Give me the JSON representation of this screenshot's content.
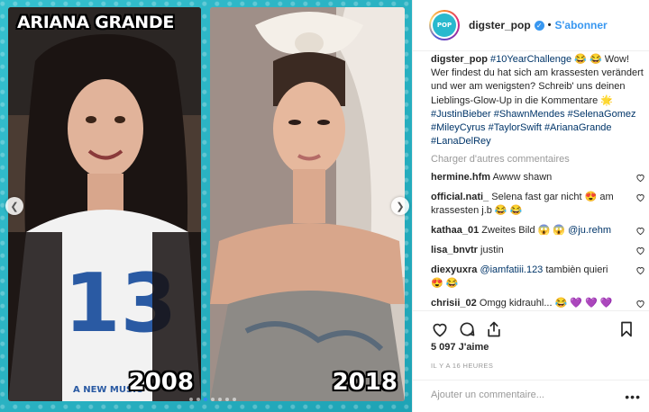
{
  "post": {
    "left_label": "ARIANA GRANDE",
    "left_year": "2008",
    "right_year": "2018",
    "shirt_text": "A NEW MUSIC"
  },
  "header": {
    "avatar_text": "POP",
    "username": "digster_pop",
    "separator": "•",
    "follow_label": "S'abonner"
  },
  "caption": {
    "username": "digster_pop",
    "hashtag": "#10YearChallenge",
    "emojis": "😂 😂",
    "text": " Wow! Wer findest du hat sich am krassesten verändert und wer am wenigsten? Schreib' uns deinen Lieblings-Glow-Up in die Kommentare 🌟 ",
    "tags": [
      "#JustinBieber",
      "#ShawnMendes",
      "#SelenaGomez",
      "#MileyCyrus",
      "#TaylorSwift",
      "#ArianaGrande",
      "#LanaDelRey"
    ]
  },
  "load_more": "Charger d'autres commentaires",
  "comments": [
    {
      "user": "hermine.hfm",
      "text": " Awww shawn"
    },
    {
      "user": "official.nati_",
      "text": " Selena fast gar nicht 😍 am krassesten j.b 😂 😂"
    },
    {
      "user": "kathaa_01",
      "text": " Zweites Bild 😱 😱 ",
      "mention": "@ju.rehm"
    },
    {
      "user": "lisa_bnvtr",
      "text": " justin"
    },
    {
      "user": "diexyuxra",
      "text": " tambièn quieri 😍 😂",
      "mention": "@iamfatiii.123",
      "mention_first": true
    },
    {
      "user": "chrisii_02",
      "text": " Omgg kidrauhl... 😂 💜 💜 💜"
    }
  ],
  "likes": "5 097 J'aime",
  "time": "IL Y A 16 HEURES",
  "add_comment_placeholder": "Ajouter un commentaire...",
  "more": "•••",
  "colors": {
    "accent": "#3897f0",
    "media_bg": "#2fb6c7",
    "text": "#262626",
    "muted": "#999999"
  },
  "icons": [
    "heart-icon",
    "comment-icon",
    "share-icon",
    "bookmark-icon",
    "verified-icon",
    "arrow-left-icon",
    "arrow-right-icon"
  ]
}
